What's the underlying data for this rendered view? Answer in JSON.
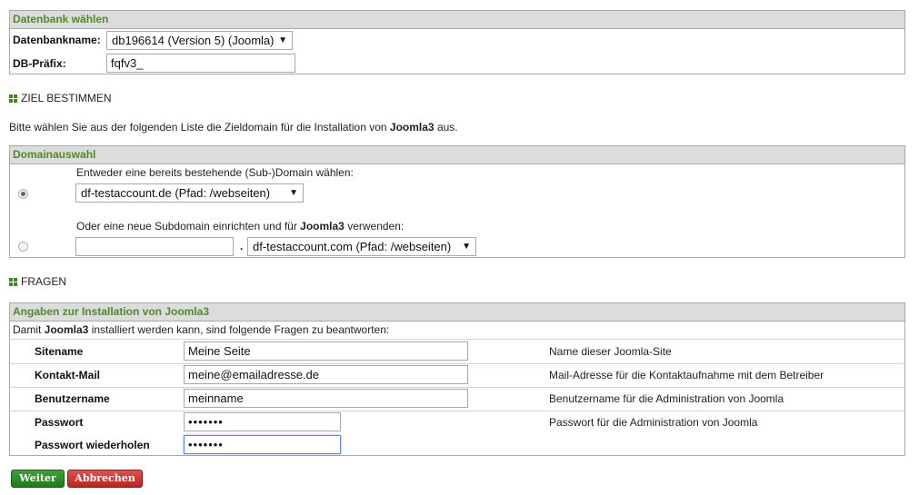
{
  "db_box": {
    "title": "Datenbank wählen",
    "db_name_label": "Datenbankname:",
    "db_name_value": "db196614 (Version 5) (Joomla)",
    "prefix_label": "DB-Präfix:",
    "prefix_value": "fqfv3_"
  },
  "ziel": {
    "heading": "ZIEL BESTIMMEN",
    "intro_pre": "Bitte wählen Sie aus der folgenden Liste die Zieldomain für die Installation von ",
    "intro_app": "Joomla3",
    "intro_post": " aus."
  },
  "domain_box": {
    "title": "Domainauswahl",
    "option1_text": "Entweder eine bereits bestehende (Sub-)Domain wählen:",
    "option1_select": "df-testaccount.de (Pfad: /webseiten)",
    "option2_text_pre": "Oder eine neue Subdomain einrichten und für ",
    "option2_text_app": "Joomla3",
    "option2_text_post": " verwenden:",
    "option2_subdomain_value": "",
    "option2_dot": ".",
    "option2_select": "df-testaccount.com (Pfad: /webseiten)",
    "selected_option": 1
  },
  "fragen": {
    "heading": "FRAGEN"
  },
  "install_box": {
    "title": "Angaben zur Installation von Joomla3",
    "intro_pre": "Damit ",
    "intro_app": "Joomla3",
    "intro_post": " installiert werden kann, sind folgende Fragen zu beantworten:",
    "rows": [
      {
        "label": "Sitename",
        "value": "Meine Seite",
        "help": "Name dieser Joomla-Site"
      },
      {
        "label": "Kontakt-Mail",
        "value": "meine@emailadresse.de",
        "help": "Mail-Adresse für die Kontaktaufnahme mit dem Betreiber"
      },
      {
        "label": "Benutzername",
        "value": "meinname",
        "help": "Benutzername für die Administration von Joomla"
      },
      {
        "label": "Passwort",
        "value": "•••••••",
        "help": "Passwort für die Administration von Joomla"
      },
      {
        "label": "Passwort wiederholen",
        "value": "•••••••",
        "help": ""
      }
    ]
  },
  "buttons": {
    "next": "Weiter",
    "cancel": "Abbrechen"
  },
  "colors": {
    "section_title": "#4e8a2a",
    "header_bg": "#dcdcdc",
    "next_button": "#2a8a25",
    "cancel_button": "#c92f2a"
  }
}
